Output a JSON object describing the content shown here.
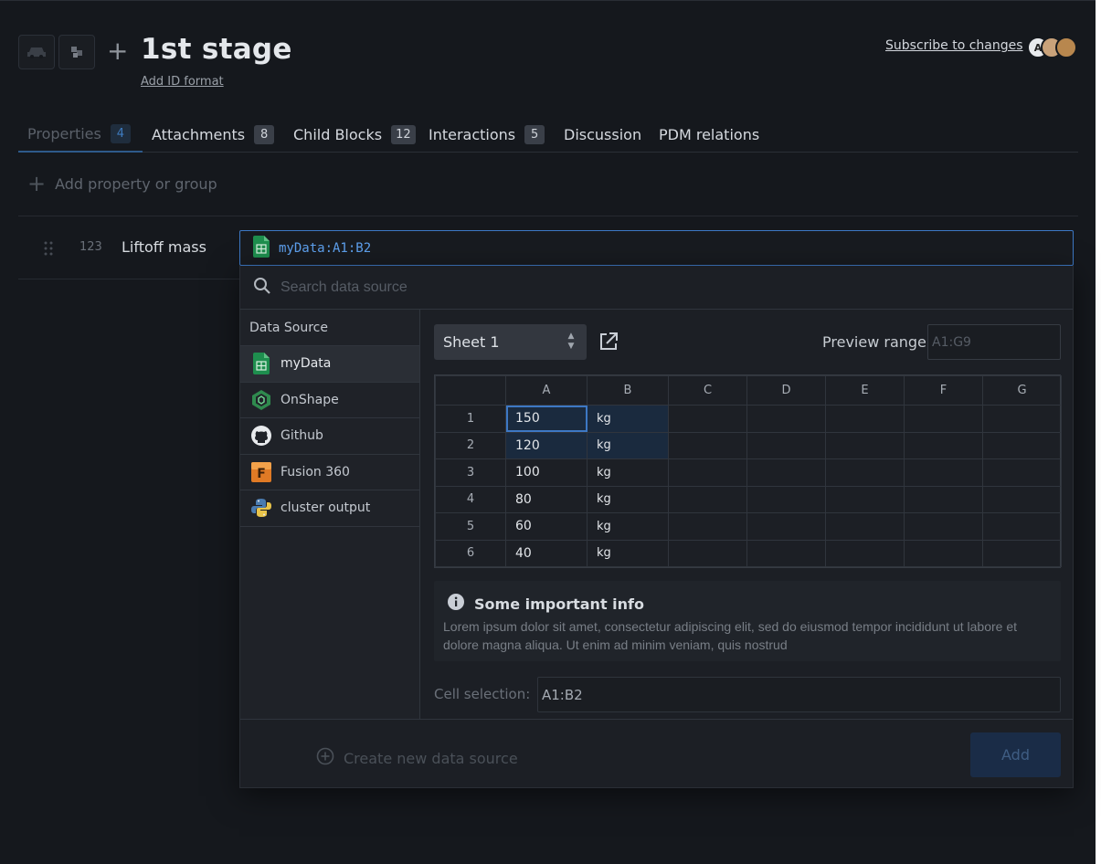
{
  "header": {
    "title": "1st stage",
    "add_id_format": "Add ID format",
    "subscribe": "Subscribe to changes",
    "avatar_initial": "A"
  },
  "tabs": [
    {
      "label": "Properties",
      "count": "4"
    },
    {
      "label": "Attachments",
      "count": "8"
    },
    {
      "label": "Child Blocks",
      "count": "12"
    },
    {
      "label": "Interactions",
      "count": "5"
    },
    {
      "label": "Discussion",
      "count": null
    },
    {
      "label": "PDM relations",
      "count": null
    }
  ],
  "add_property": "Add property or group",
  "property": {
    "type_label": "123",
    "name": "Liftoff mass"
  },
  "formula": "myData:A1:B2",
  "search": {
    "placeholder": "Search data source"
  },
  "data_source": {
    "heading": "Data Source",
    "items": [
      {
        "label": "myData",
        "icon": "google-sheets-icon"
      },
      {
        "label": "OnShape",
        "icon": "onshape-icon"
      },
      {
        "label": "Github",
        "icon": "github-icon"
      },
      {
        "label": "Fusion 360",
        "icon": "fusion-360-icon"
      },
      {
        "label": "cluster output",
        "icon": "python-icon"
      }
    ]
  },
  "sheet": {
    "selected": "Sheet 1"
  },
  "preview": {
    "label": "Preview range",
    "placeholder": "A1:G9"
  },
  "grid": {
    "columns": [
      "A",
      "B",
      "C",
      "D",
      "E",
      "F",
      "G"
    ],
    "rows": [
      {
        "n": "1",
        "a": "150",
        "b": "kg"
      },
      {
        "n": "2",
        "a": "120",
        "b": "kg"
      },
      {
        "n": "3",
        "a": "100",
        "b": "kg"
      },
      {
        "n": "4",
        "a": "80",
        "b": "kg"
      },
      {
        "n": "5",
        "a": "60",
        "b": "kg"
      },
      {
        "n": "6",
        "a": "40",
        "b": "kg"
      }
    ]
  },
  "info": {
    "title": "Some important info",
    "body": "Lorem ipsum dolor sit amet, consectetur adipiscing elit, sed do eiusmod tempor incididunt ut labore et dolore magna aliqua. Ut enim ad minim veniam, quis nostrud"
  },
  "cell_selection": {
    "label": "Cell selection:",
    "value": "A1:B2"
  },
  "footer": {
    "create_new": "Create new data source",
    "add": "Add"
  },
  "colors": {
    "accent": "#3d78c4",
    "background": "#15181d",
    "panel": "#1c1f25"
  }
}
